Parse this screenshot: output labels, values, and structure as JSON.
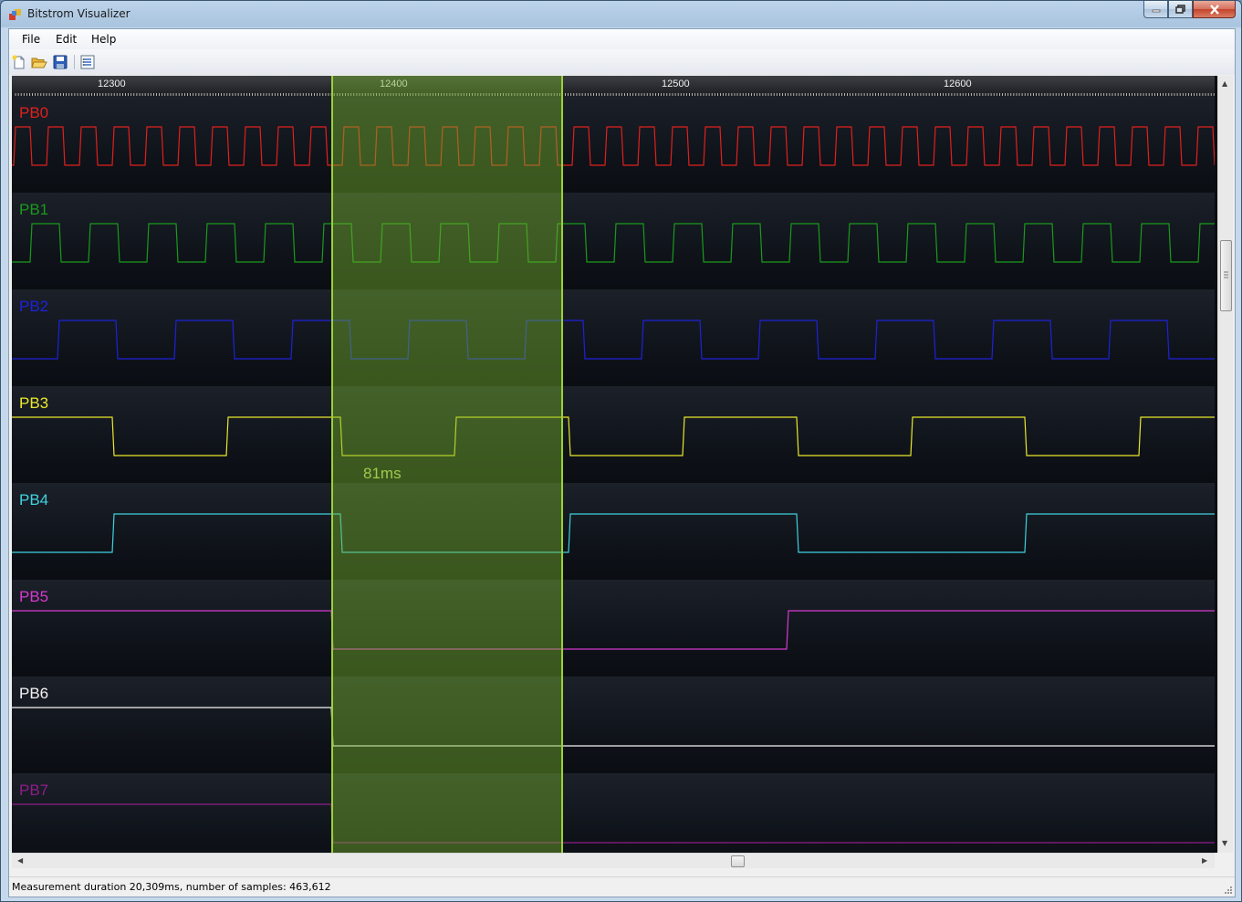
{
  "window": {
    "title": "Bitstrom Visualizer"
  },
  "menu": [
    "File",
    "Edit",
    "Help"
  ],
  "toolbar": {
    "icons": [
      "new-file-icon",
      "open-folder-icon",
      "save-icon",
      "settings-list-icon"
    ]
  },
  "ruler": {
    "labels": [
      "12300",
      "12400",
      "12500",
      "12600"
    ]
  },
  "channels": [
    {
      "name": "PB0",
      "color": "#e0201d"
    },
    {
      "name": "PB1",
      "color": "#1a9a1d"
    },
    {
      "name": "PB2",
      "color": "#1d22d8"
    },
    {
      "name": "PB3",
      "color": "#e9e92a"
    },
    {
      "name": "PB4",
      "color": "#3fd2e0"
    },
    {
      "name": "PB5",
      "color": "#d63ad0"
    },
    {
      "name": "PB6",
      "color": "#f4f4f4"
    },
    {
      "name": "PB7",
      "color": "#8d1e8a"
    }
  ],
  "selection": {
    "label": "81ms",
    "color": "#9bd03a"
  },
  "status": {
    "text": "Measurement duration 20,309ms, number of samples: 463,612"
  }
}
